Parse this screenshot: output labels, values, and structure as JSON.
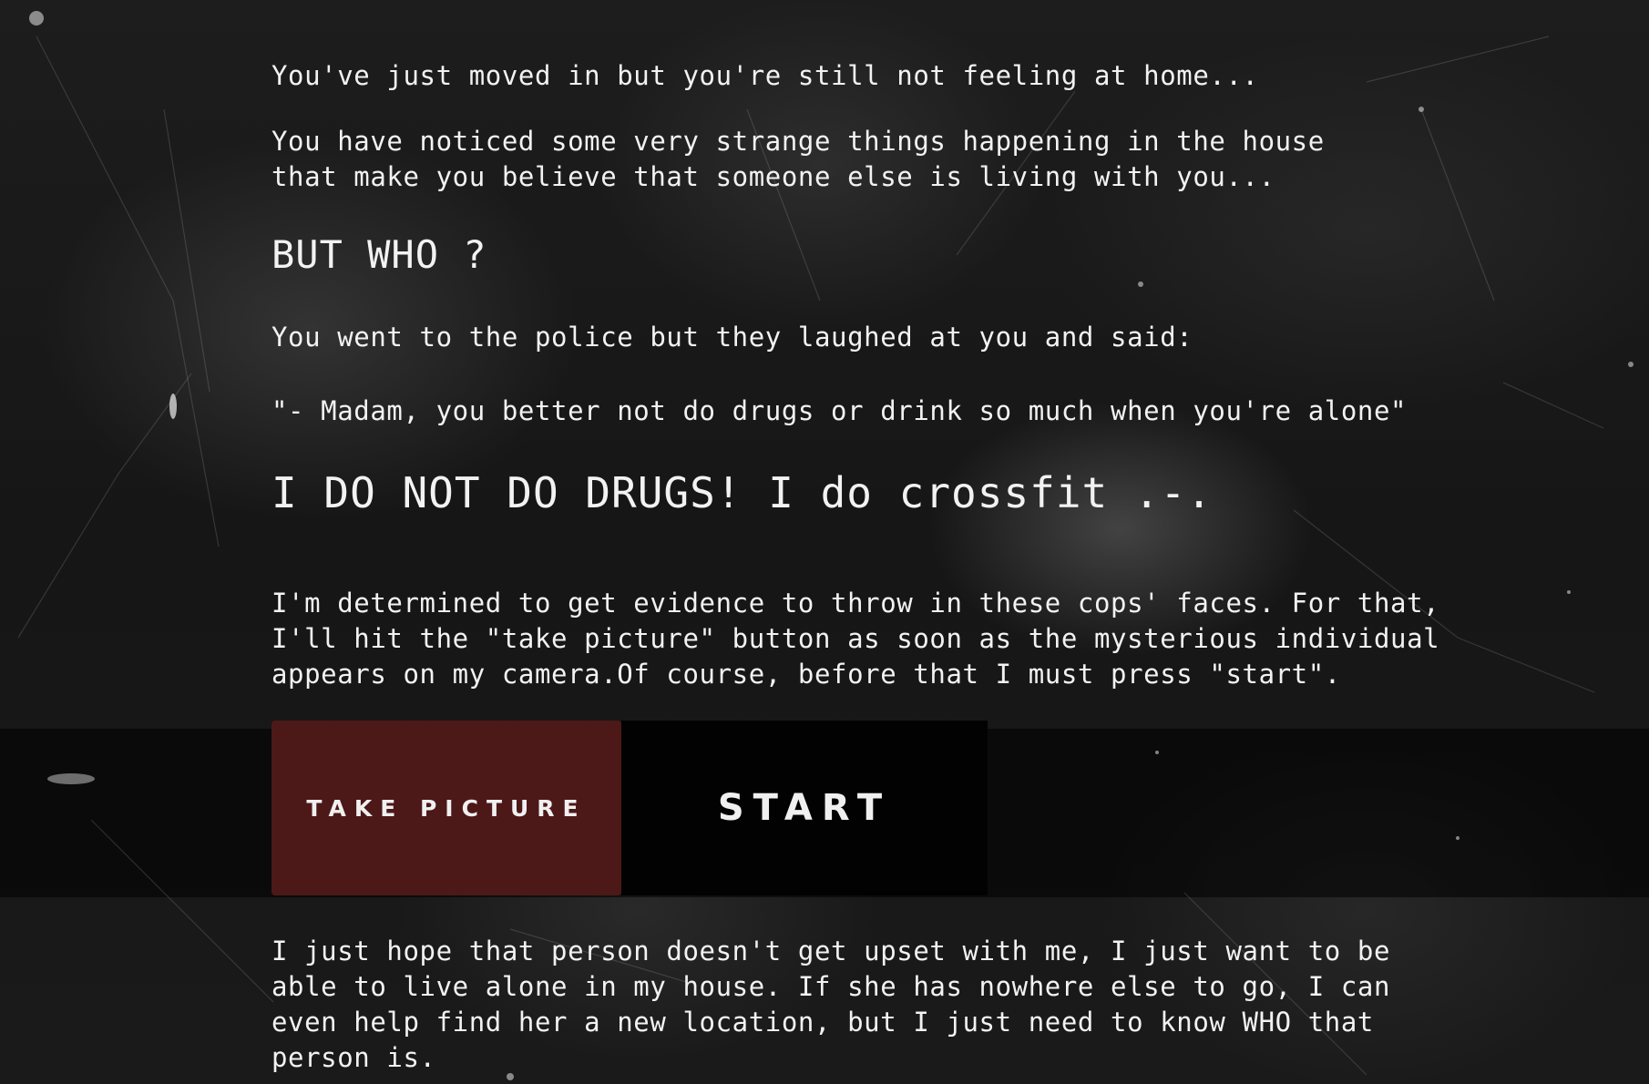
{
  "story": {
    "line1": "You've just moved in but you're still not feeling at home...",
    "line2a": "You have noticed some very strange things happening in the house",
    "line2b": "that make you believe that someone else is living with you...",
    "heading_who": "BUT WHO ?",
    "police_line": "You went to the police but they laughed at you and said:",
    "police_quote": "\"- Madam, you better not do drugs or drink so much when you're alone\"",
    "heading_drugs": "I DO NOT DO DRUGS! I do crossfit .-.",
    "plan_a": "I'm determined to get evidence to throw in these cops' faces. For that,",
    "plan_b": "I'll hit the \"take picture\" button as soon as the mysterious individual",
    "plan_c": "appears on my camera.Of course, before that I must press \"start\".",
    "hope_a": "I just hope that person doesn't get upset with me, I just want to be",
    "hope_b": "able to live alone in my house. If she has nowhere else to go, I can",
    "hope_c": "even help find her a new location, but I just need to know WHO that",
    "hope_d": "person is."
  },
  "buttons": {
    "take_picture": "TAKE PICTURE",
    "start": "START"
  },
  "colors": {
    "background": "#141414",
    "take_picture_bg": "#4d1818",
    "start_bg": "#020202",
    "text": "#f2f2f2"
  }
}
